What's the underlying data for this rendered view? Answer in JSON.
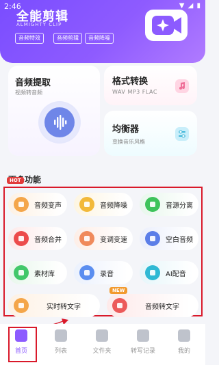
{
  "status": {
    "time": "2:46",
    "icons": "▼ ◢ ▮"
  },
  "app": {
    "title": "全能剪辑",
    "subtitle": "ALMIGHTY CLIP",
    "tags": [
      "音频特效",
      "音频剪辑",
      "音频降噪"
    ]
  },
  "cards": {
    "extract": {
      "title": "音频提取",
      "desc": "视频转音频"
    },
    "format": {
      "title": "格式转换",
      "desc": "WAV  MP3  FLAC"
    },
    "eq": {
      "title": "均衡器",
      "desc": "变换音乐风格"
    }
  },
  "more": {
    "title": "更多功能",
    "hot_badge": "HOT",
    "new_badge": "NEW",
    "items": [
      {
        "label": "音频变声",
        "icon": "microphone-icon",
        "color": "#f4a64a",
        "bg": "#fdf1e4"
      },
      {
        "label": "音频降噪",
        "icon": "noise-reduce-icon",
        "color": "#f2b93a",
        "bg": "#fdf5e2"
      },
      {
        "label": "音源分离",
        "icon": "separate-icon",
        "color": "#3ec35b",
        "bg": "#e8f7ec"
      },
      {
        "label": "音频合并",
        "icon": "merge-icon",
        "color": "#ec4b4b",
        "bg": "#fde9e9"
      },
      {
        "label": "变调变速",
        "icon": "speed-icon",
        "color": "#f08a5b",
        "bg": "#fdeee7"
      },
      {
        "label": "空白音频",
        "icon": "blank-audio-icon",
        "color": "#5b7ee8",
        "bg": "#ebeffc"
      },
      {
        "label": "素材库",
        "icon": "library-icon",
        "color": "#42c86a",
        "bg": "#e8f7ec"
      },
      {
        "label": "录音",
        "icon": "record-icon",
        "color": "#5b8ef0",
        "bg": "#ebf1fd"
      },
      {
        "label": "AI配音",
        "icon": "ai-voice-icon",
        "color": "#2fb9d4",
        "bg": "#e6f6fa"
      },
      {
        "label": "实时转文字",
        "icon": "realtime-text-icon",
        "color": "#f4a64a",
        "bg": "#fdf1e4"
      },
      {
        "label": "音频转文字",
        "icon": "audio-text-icon",
        "color": "#ec5a5a",
        "bg": "#fdeaea"
      }
    ]
  },
  "nav": {
    "items": [
      {
        "label": "首页",
        "icon": "home-icon",
        "active": true
      },
      {
        "label": "列表",
        "icon": "list-icon",
        "active": false
      },
      {
        "label": "文件夹",
        "icon": "folder-icon",
        "active": false
      },
      {
        "label": "转写记录",
        "icon": "transcribe-icon",
        "active": false
      },
      {
        "label": "我的",
        "icon": "profile-icon",
        "active": false
      }
    ]
  },
  "colors": {
    "accent": "#8c5bff",
    "highlight": "#d9192a",
    "nav_inactive": "#bfc3cc"
  }
}
